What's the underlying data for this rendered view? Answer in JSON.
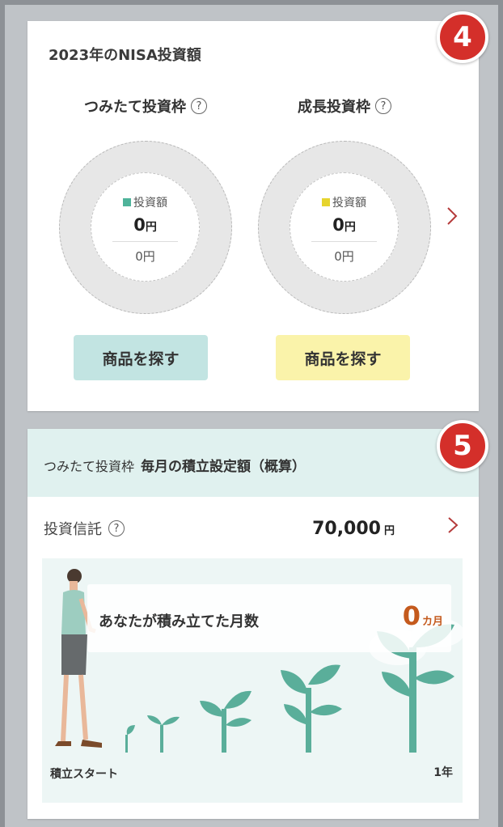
{
  "nisa": {
    "badge": "4",
    "title": "2023年のNISA投資額",
    "tsumitate": {
      "heading": "つみたて投資枠",
      "help": "?",
      "legend": "投資額",
      "amount": "0",
      "amount_unit": "円",
      "limit": "0円",
      "legend_color": "#4fb39a",
      "button": "商品を探す"
    },
    "growth": {
      "heading": "成長投資枠",
      "help": "?",
      "legend": "投資額",
      "amount": "0",
      "amount_unit": "円",
      "limit": "0円",
      "legend_color": "#e6d42e",
      "button": "商品を探す"
    },
    "next_icon": "chevron-right-icon"
  },
  "monthly": {
    "badge": "5",
    "header_prefix": "つみたて投資枠",
    "header_main": "毎月の積立設定額（概算）",
    "row_label": "投資信託",
    "row_help": "?",
    "row_value": "70,000",
    "row_unit": "円",
    "months_label": "あなたが積み立てた月数",
    "months_value": "0",
    "months_unit": "カ月",
    "start_label": "積立スタート",
    "end_label": "1年"
  },
  "colors": {
    "accent_red": "#d42f2a",
    "plant_green": "#5aae9a",
    "tsumitate_btn": "#c2e4e2",
    "growth_btn": "#faf3aa"
  }
}
